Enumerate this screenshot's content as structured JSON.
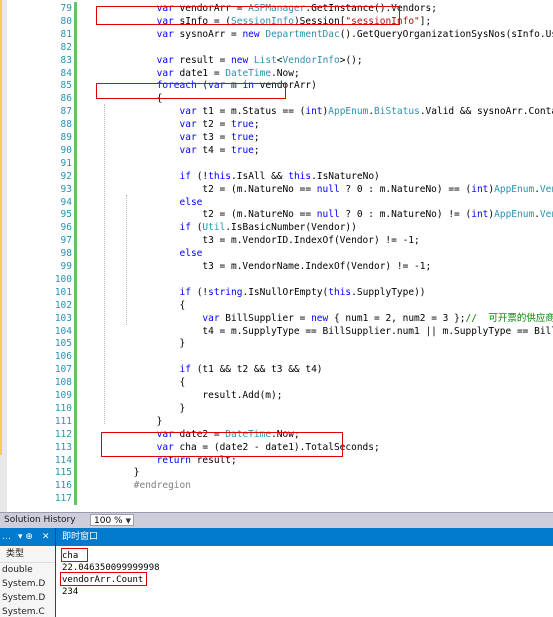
{
  "editor": {
    "lines": [
      {
        "n": "79",
        "code": [
          [
            "            "
          ],
          [
            "var ",
            "kw"
          ],
          [
            "vendorArr = "
          ],
          [
            "ASPManager",
            "ty"
          ],
          [
            ".GetInstance().Vendors;"
          ]
        ]
      },
      {
        "n": "80",
        "code": [
          [
            "            "
          ],
          [
            "var ",
            "kw"
          ],
          [
            "sInfo = ("
          ],
          [
            "SessionInfo",
            "ty"
          ],
          [
            ")Session["
          ],
          [
            "\"sessionInfo\"",
            "str"
          ],
          [
            "];"
          ]
        ]
      },
      {
        "n": "81",
        "code": [
          [
            "            "
          ],
          [
            "var ",
            "kw"
          ],
          [
            "sysnoArr = "
          ],
          [
            "new ",
            "kw"
          ],
          [
            "DepartmentDac",
            "ty"
          ],
          [
            "().GetQueryOrganizationSysNos(sInfo.User.SysNo,"
          ]
        ]
      },
      {
        "n": "82",
        "code": [
          [
            ""
          ]
        ]
      },
      {
        "n": "83",
        "code": [
          [
            "            "
          ],
          [
            "var ",
            "kw"
          ],
          [
            "result = "
          ],
          [
            "new ",
            "kw"
          ],
          [
            "List",
            "ty"
          ],
          [
            "<"
          ],
          [
            "VendorInfo",
            "ty"
          ],
          [
            ">();"
          ]
        ]
      },
      {
        "n": "84",
        "code": [
          [
            "            "
          ],
          [
            "var ",
            "kw"
          ],
          [
            "date1 = "
          ],
          [
            "DateTime",
            "ty"
          ],
          [
            ".Now;"
          ]
        ]
      },
      {
        "n": "85",
        "code": [
          [
            "            "
          ],
          [
            "foreach ",
            "kw"
          ],
          [
            "("
          ],
          [
            "var ",
            "kw"
          ],
          [
            "m "
          ],
          [
            "in ",
            "kw"
          ],
          [
            "vendorArr)"
          ]
        ]
      },
      {
        "n": "86",
        "code": [
          [
            "            {"
          ]
        ]
      },
      {
        "n": "87",
        "code": [
          [
            "                "
          ],
          [
            "var ",
            "kw"
          ],
          [
            "t1 = m.Status == ("
          ],
          [
            "int",
            "kw"
          ],
          [
            ")"
          ],
          [
            "AppEnum",
            "ty"
          ],
          [
            "."
          ],
          [
            "BiStatus",
            "ty"
          ],
          [
            ".Valid && sysnoArr.Contains(m.Org"
          ]
        ]
      },
      {
        "n": "88",
        "code": [
          [
            "                "
          ],
          [
            "var ",
            "kw"
          ],
          [
            "t2 = "
          ],
          [
            "true",
            "kw"
          ],
          [
            ";"
          ]
        ]
      },
      {
        "n": "89",
        "code": [
          [
            "                "
          ],
          [
            "var ",
            "kw"
          ],
          [
            "t3 = "
          ],
          [
            "true",
            "kw"
          ],
          [
            ";"
          ]
        ]
      },
      {
        "n": "90",
        "code": [
          [
            "                "
          ],
          [
            "var ",
            "kw"
          ],
          [
            "t4 = "
          ],
          [
            "true",
            "kw"
          ],
          [
            ";"
          ]
        ]
      },
      {
        "n": "91",
        "code": [
          [
            ""
          ]
        ]
      },
      {
        "n": "92",
        "code": [
          [
            "                "
          ],
          [
            "if ",
            "kw"
          ],
          [
            "(!"
          ],
          [
            "this",
            "kw"
          ],
          [
            ".IsAll && "
          ],
          [
            "this",
            "kw"
          ],
          [
            ".IsNatureNo)"
          ]
        ]
      },
      {
        "n": "93",
        "code": [
          [
            "                    t2 = (m.NatureNo == "
          ],
          [
            "null",
            "kw"
          ],
          [
            " ? 0 : m.NatureNo) == ("
          ],
          [
            "int",
            "kw"
          ],
          [
            ")"
          ],
          [
            "AppEnum",
            "ty"
          ],
          [
            "."
          ],
          [
            "VendorNature",
            "ty"
          ]
        ]
      },
      {
        "n": "94",
        "code": [
          [
            "                "
          ],
          [
            "else",
            "kw"
          ]
        ]
      },
      {
        "n": "95",
        "code": [
          [
            "                    t2 = (m.NatureNo == "
          ],
          [
            "null",
            "kw"
          ],
          [
            " ? 0 : m.NatureNo) != ("
          ],
          [
            "int",
            "kw"
          ],
          [
            ")"
          ],
          [
            "AppEnum",
            "ty"
          ],
          [
            "."
          ],
          [
            "VendorNature",
            "ty"
          ]
        ]
      },
      {
        "n": "96",
        "code": [
          [
            "                "
          ],
          [
            "if ",
            "kw"
          ],
          [
            "("
          ],
          [
            "Util",
            "ty"
          ],
          [
            ".IsBasicNumber(Vendor))"
          ]
        ]
      },
      {
        "n": "97",
        "code": [
          [
            "                    t3 = m.VendorID.IndexOf(Vendor) != -1;"
          ]
        ]
      },
      {
        "n": "98",
        "code": [
          [
            "                "
          ],
          [
            "else",
            "kw"
          ]
        ]
      },
      {
        "n": "99",
        "code": [
          [
            "                    t3 = m.VendorName.IndexOf(Vendor) != -1;"
          ]
        ]
      },
      {
        "n": "100",
        "code": [
          [
            ""
          ]
        ]
      },
      {
        "n": "101",
        "code": [
          [
            "                "
          ],
          [
            "if ",
            "kw"
          ],
          [
            "(!"
          ],
          [
            "string",
            "kw"
          ],
          [
            ".IsNullOrEmpty("
          ],
          [
            "this",
            "kw"
          ],
          [
            ".SupplyType))"
          ]
        ]
      },
      {
        "n": "102",
        "code": [
          [
            "                {"
          ]
        ]
      },
      {
        "n": "103",
        "code": [
          [
            "                    "
          ],
          [
            "var ",
            "kw"
          ],
          [
            "BillSupplier = "
          ],
          [
            "new ",
            "kw"
          ],
          [
            "{ num1 = 2, num2 = 3 };"
          ],
          [
            "//  可开票的供应商(仅票据",
            "cm"
          ]
        ]
      },
      {
        "n": "104",
        "code": [
          [
            "                    t4 = m.SupplyType == BillSupplier.num1 || m.SupplyType == BillSupplier."
          ]
        ]
      },
      {
        "n": "105",
        "code": [
          [
            "                }"
          ]
        ]
      },
      {
        "n": "106",
        "code": [
          [
            ""
          ]
        ]
      },
      {
        "n": "107",
        "code": [
          [
            "                "
          ],
          [
            "if ",
            "kw"
          ],
          [
            "(t1 && t2 && t3 && t4)"
          ]
        ]
      },
      {
        "n": "108",
        "code": [
          [
            "                {"
          ]
        ]
      },
      {
        "n": "109",
        "code": [
          [
            "                    result.Add(m);"
          ]
        ]
      },
      {
        "n": "110",
        "code": [
          [
            "                }"
          ]
        ]
      },
      {
        "n": "111",
        "code": [
          [
            "            }"
          ]
        ]
      },
      {
        "n": "112",
        "code": [
          [
            "            "
          ],
          [
            "var ",
            "kw"
          ],
          [
            "date2 = "
          ],
          [
            "DateTime",
            "ty"
          ],
          [
            ".Now;"
          ]
        ]
      },
      {
        "n": "113",
        "code": [
          [
            "            "
          ],
          [
            "var ",
            "kw"
          ],
          [
            "cha = (date2 - date1).TotalSeconds;"
          ]
        ]
      },
      {
        "n": "114",
        "code": [
          [
            "            "
          ],
          [
            "return ",
            "kw"
          ],
          [
            "result;"
          ]
        ]
      },
      {
        "n": "115",
        "code": [
          [
            "        }"
          ]
        ]
      },
      {
        "n": "116",
        "code": [
          [
            "        "
          ],
          [
            "#endregion",
            "pp"
          ]
        ]
      },
      {
        "n": "117",
        "code": [
          [
            ""
          ]
        ]
      }
    ]
  },
  "statusbar": {
    "tab_label": "Solution History",
    "zoom": "100 %"
  },
  "locals_panel": {
    "title_left": "…",
    "pin_glyph": "▾ ⊕",
    "close_glyph": "✕",
    "column_header": "类型",
    "rows": [
      "double",
      "System.D",
      "System.D",
      "System.C"
    ]
  },
  "immediate_window": {
    "title": "即时窗口",
    "lines": [
      "cha",
      "22.046350099999998",
      "vendorArr.Count",
      "234"
    ]
  },
  "colors": {
    "highlight_box": "#e00000",
    "panel_header": "#007acc",
    "line_number": "#2b91af",
    "keyword": "#0000ff",
    "type": "#2b91af"
  }
}
